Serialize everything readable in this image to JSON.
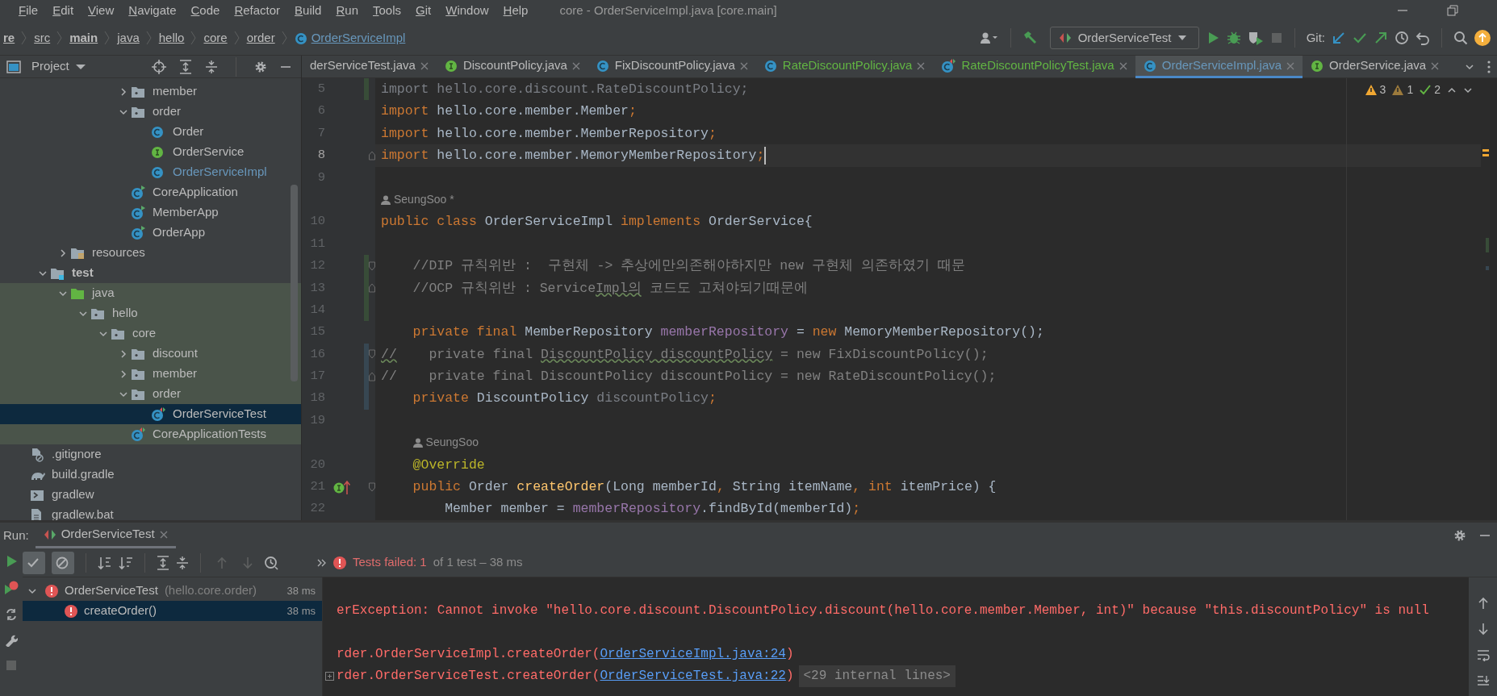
{
  "menu": [
    "File",
    "Edit",
    "View",
    "Navigate",
    "Code",
    "Refactor",
    "Build",
    "Run",
    "Tools",
    "Git",
    "Window",
    "Help"
  ],
  "window": {
    "title": "core - OrderServiceImpl.java [core.main]"
  },
  "breadcrumb": [
    {
      "label": "re",
      "bold": true
    },
    {
      "label": "src",
      "bold": false
    },
    {
      "label": "main",
      "bold": true
    },
    {
      "label": "java",
      "bold": false
    },
    {
      "label": "hello",
      "bold": false
    },
    {
      "label": "core",
      "bold": false
    },
    {
      "label": "order",
      "bold": false
    },
    {
      "label": "OrderServiceImpl",
      "bold": false,
      "kind": "class",
      "color": "#6897bb"
    }
  ],
  "toolbar": {
    "run_config": "OrderServiceTest",
    "git_label": "Git:",
    "actions": [
      {
        "kind": "run",
        "disabled": false
      },
      {
        "kind": "debug",
        "disabled": false
      },
      {
        "kind": "coverage",
        "disabled": false
      },
      {
        "kind": "stop",
        "disabled": true
      }
    ]
  },
  "project": {
    "title": "Project",
    "items": [
      {
        "children": [
          {
            "children": [
              {
                "children": [
                  {
                    "children": [
                      {
                        "children": [
                          {
                            "children": [
                              {
                                "label": "member",
                                "kind": "package",
                                "expanded": false,
                                "selected": false
                              },
                              {
                                "label": "order",
                                "kind": "package",
                                "expanded": true,
                                "selected": false,
                                "children": [
                                  {
                                    "label": "Order",
                                    "kind": "class",
                                    "selected": false
                                  },
                                  {
                                    "label": "OrderService",
                                    "kind": "interface",
                                    "selected": false
                                  },
                                  {
                                    "label": "OrderServiceImpl",
                                    "kind": "class",
                                    "selected": false,
                                    "color": "#6897bb"
                                  }
                                ]
                              },
                              {
                                "label": "CoreApplication",
                                "kind": "main_class",
                                "selected": false
                              },
                              {
                                "label": "MemberApp",
                                "kind": "main_class",
                                "selected": false
                              },
                              {
                                "label": "OrderApp",
                                "kind": "main_class",
                                "selected": false
                              }
                            ]
                          }
                        ]
                      }
                    ]
                  },
                  {
                    "label": "resources",
                    "kind": "resources",
                    "expanded": false,
                    "selected": false
                  }
                ]
              },
              {
                "label": "test",
                "kind": "test_root",
                "expanded": true,
                "selected": false,
                "bold": true,
                "children": [
                  {
                    "label": "java",
                    "kind": "test_source",
                    "expanded": true,
                    "selected": false,
                    "test_scope": true,
                    "children": [
                      {
                        "label": "hello",
                        "kind": "package",
                        "expanded": true,
                        "selected": false,
                        "children": [
                          {
                            "label": "core",
                            "kind": "package",
                            "expanded": true,
                            "selected": false,
                            "children": [
                              {
                                "label": "discount",
                                "kind": "package",
                                "expanded": false,
                                "selected": false
                              },
                              {
                                "label": "member",
                                "kind": "package",
                                "expanded": false,
                                "selected": false
                              },
                              {
                                "label": "order",
                                "kind": "package",
                                "expanded": true,
                                "selected": false,
                                "children": [
                                  {
                                    "label": "OrderServiceTest",
                                    "kind": "test_class",
                                    "selected": true
                                  }
                                ]
                              },
                              {
                                "label": "CoreApplicationTests",
                                "kind": "test_class",
                                "selected": false
                              }
                            ]
                          }
                        ]
                      }
                    ]
                  }
                ]
              }
            ]
          },
          {
            "label": ".gitignore",
            "kind": "ignore_file",
            "selected": false
          },
          {
            "label": "build.gradle",
            "kind": "gradle",
            "selected": false
          },
          {
            "label": "gradlew",
            "kind": "script",
            "selected": false
          },
          {
            "label": "gradlew.bat",
            "kind": "bat_file",
            "selected": false
          }
        ]
      }
    ]
  },
  "tabs": [
    {
      "label": "derServiceTest.java",
      "selected": false
    },
    {
      "label": "DiscountPolicy.java",
      "kind": "interface",
      "selected": false
    },
    {
      "label": "FixDiscountPolicy.java",
      "kind": "class",
      "selected": false
    },
    {
      "label": "RateDiscountPolicy.java",
      "kind": "class",
      "color": "#62b543",
      "selected": false
    },
    {
      "label": "RateDiscountPolicyTest.java",
      "kind": "test_class",
      "color": "#62b543",
      "selected": false
    },
    {
      "label": "OrderServiceImpl.java",
      "kind": "class",
      "color": "#6897bb",
      "selected": true
    },
    {
      "label": "OrderService.java",
      "kind": "interface",
      "selected": false
    }
  ],
  "inspections": [
    {
      "kind": "warning",
      "count": "3"
    },
    {
      "kind": "weak_warning",
      "count": "1"
    },
    {
      "kind": "typo",
      "count": "2"
    }
  ],
  "editor": {
    "lines": [
      {
        "kind": "code",
        "num": "5",
        "color": "#384c38",
        "tokens": [
          {
            "text": "import hello.core.discount.RateDiscountPolicy;",
            "kind": "u"
          }
        ]
      },
      {
        "kind": "code",
        "num": "6",
        "tokens": [
          {
            "text": "import",
            "kind": "k"
          },
          {
            "text": " hello.core.member.Member",
            "kind": "p"
          },
          {
            "text": ";",
            "kind": "k"
          }
        ]
      },
      {
        "kind": "code",
        "num": "7",
        "tokens": [
          {
            "text": "import",
            "kind": "k"
          },
          {
            "text": " hello.core.member.MemberRepository",
            "kind": "p"
          },
          {
            "text": ";",
            "kind": "k"
          }
        ]
      },
      {
        "kind": "code",
        "num": "8",
        "current": true,
        "fold_close": true,
        "tokens": [
          {
            "text": "import",
            "kind": "k"
          },
          {
            "text": " hello.core.member.MemoryMemberRepository",
            "kind": "p"
          },
          {
            "text": ";",
            "kind": "k"
          }
        ]
      },
      {
        "kind": "code",
        "num": "9"
      },
      {
        "kind": "author",
        "text": "SeungSoo *"
      },
      {
        "kind": "code",
        "num": "10",
        "tokens": [
          {
            "text": "public class",
            "kind": "k"
          },
          {
            "text": " OrderServiceImpl ",
            "kind": "p"
          },
          {
            "text": "implements",
            "kind": "k"
          },
          {
            "text": " OrderService{",
            "kind": "p"
          }
        ]
      },
      {
        "kind": "code",
        "num": "11"
      },
      {
        "kind": "code",
        "num": "12",
        "color": "#384c38",
        "fold_open": true,
        "tokens": [
          {
            "text": "    //DIP 규칙위반 :  구현체 -> 추상에만의존해야하지만 new 구현체 의존하였기 때문",
            "kind": "c"
          }
        ]
      },
      {
        "kind": "code",
        "num": "13",
        "color": "#384c38",
        "fold_close": true,
        "tokens": [
          {
            "text": "    //OCP 규칙위반 : Service",
            "kind": "c"
          },
          {
            "text": "Impl의",
            "kind": "cw"
          },
          {
            "text": " 코드도 고쳐야되기때문에",
            "kind": "c"
          }
        ]
      },
      {
        "kind": "code",
        "num": "14",
        "color": "#384c38"
      },
      {
        "kind": "code",
        "num": "15",
        "tokens": [
          {
            "text": "    private final",
            "kind": "k"
          },
          {
            "text": " MemberRepository ",
            "kind": "p"
          },
          {
            "text": "memberRepository",
            "kind": "f"
          },
          {
            "text": " = ",
            "kind": "p"
          },
          {
            "text": "new",
            "kind": "k"
          },
          {
            "text": " MemoryMemberRepository();",
            "kind": "p"
          }
        ]
      },
      {
        "kind": "code",
        "num": "16",
        "color": "#374752",
        "fold_open": true,
        "tokens": [
          {
            "text": "//",
            "kind": "cw"
          },
          {
            "text": "    private final ",
            "kind": "c"
          },
          {
            "text": "DiscountPolicy discountPolicy",
            "kind": "cw"
          },
          {
            "text": " = new FixDiscountPolicy();",
            "kind": "c"
          }
        ]
      },
      {
        "kind": "code",
        "num": "17",
        "color": "#374752",
        "fold_close": true,
        "tokens": [
          {
            "text": "//    private final DiscountPolicy discountPolicy = new RateDiscountPolicy();",
            "kind": "c"
          }
        ]
      },
      {
        "kind": "code",
        "num": "18",
        "color": "#374752",
        "tokens": [
          {
            "text": "    private",
            "kind": "k"
          },
          {
            "text": " DiscountPolicy ",
            "kind": "p"
          },
          {
            "text": "discountPolicy",
            "kind": "u"
          },
          {
            "text": ";",
            "kind": "k"
          }
        ]
      },
      {
        "kind": "code",
        "num": "19"
      },
      {
        "kind": "author",
        "text": "SeungSoo"
      },
      {
        "kind": "code",
        "num": "20",
        "tokens": [
          {
            "text": "    @Override",
            "kind": "a"
          }
        ]
      },
      {
        "kind": "code",
        "num": "21",
        "fold_open": true,
        "implemented": true,
        "tokens": [
          {
            "text": "    public",
            "kind": "k"
          },
          {
            "text": " Order ",
            "kind": "p"
          },
          {
            "text": "createOrder",
            "kind": "m"
          },
          {
            "text": "(Long memberId",
            "kind": "p"
          },
          {
            "text": ", ",
            "kind": "k"
          },
          {
            "text": "String itemName",
            "kind": "p"
          },
          {
            "text": ", ",
            "kind": "k"
          },
          {
            "text": "int",
            "kind": "k"
          },
          {
            "text": " itemPrice) {",
            "kind": "p"
          }
        ]
      },
      {
        "kind": "code",
        "num": "22",
        "tokens": [
          {
            "text": "        Member member = ",
            "kind": "p"
          },
          {
            "text": "memberRepository",
            "kind": "f"
          },
          {
            "text": ".findById(memberId)",
            "kind": "p"
          },
          {
            "text": ";",
            "kind": "k"
          }
        ]
      }
    ]
  },
  "run": {
    "label": "Run:",
    "tab": {
      "label": "OrderServiceTest",
      "selected": true
    },
    "toggles": [
      {
        "kind": "show_passed",
        "on": true
      },
      {
        "kind": "show_ignored",
        "on": true
      }
    ],
    "nav": [
      {
        "kind": "previous",
        "disabled": true
      },
      {
        "kind": "next",
        "disabled": true
      }
    ],
    "status": {
      "failed": "Tests failed: 1",
      "rest": "of 1 test – 38 ms"
    },
    "results": [
      {
        "name": "OrderServiceTest",
        "package": "(hello.core.order)",
        "time": "38 ms",
        "kind": "failed",
        "expanded": true,
        "selected": false,
        "children": [
          {
            "name": "createOrder()",
            "time": "38 ms",
            "kind": "failed",
            "selected": true
          }
        ]
      }
    ],
    "console": [
      {
        "kind": "error",
        "text": "erException: Cannot invoke \"hello.core.discount.DiscountPolicy.discount(hello.core.member.Member, int)\" because \"this.discountPolicy\" is null"
      },
      {
        "kind": "trace",
        "collapsible": false,
        "prefix": "rder.OrderServiceImpl.createOrder(",
        "link": "OrderServiceImpl.java:24",
        "suffix": ")"
      },
      {
        "kind": "trace",
        "collapsible": true,
        "prefix": "rder.OrderServiceTest.createOrder(",
        "link": "OrderServiceTest.java:22",
        "suffix": ")",
        "folded": "<29 internal lines>"
      }
    ]
  }
}
